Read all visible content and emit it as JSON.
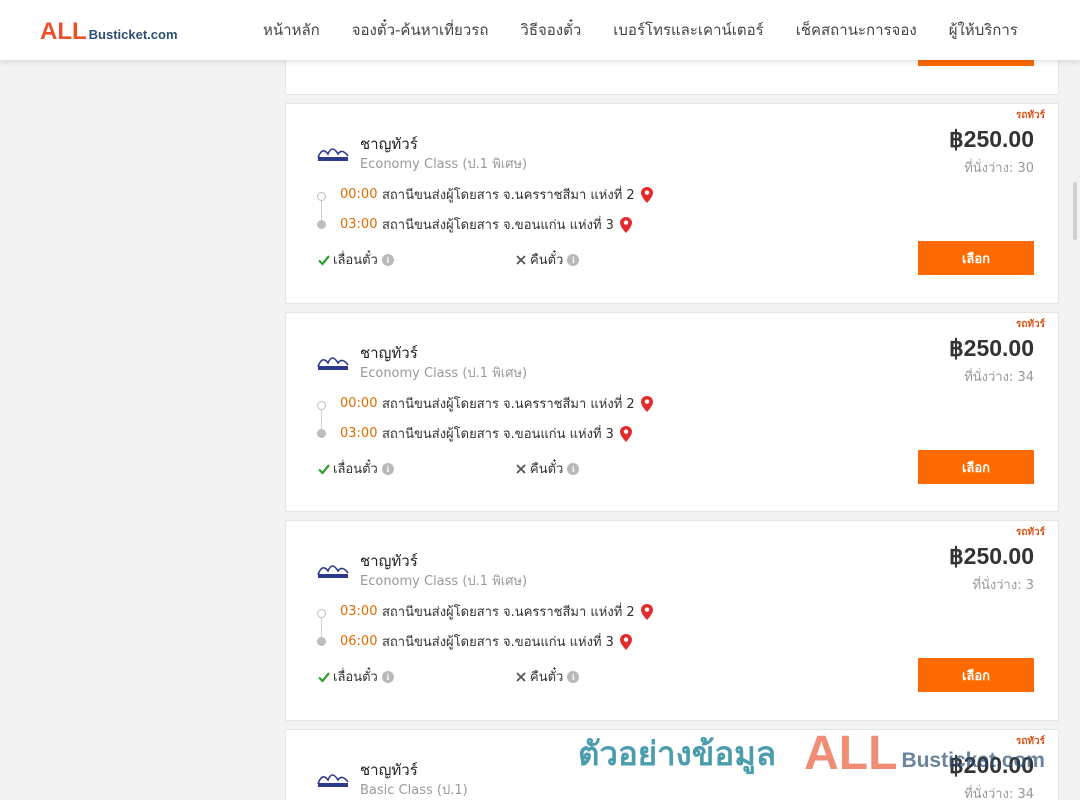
{
  "header": {
    "logo_primary": "ALL",
    "logo_secondary": "Busticket.com",
    "nav": [
      {
        "label": "หน้าหลัก"
      },
      {
        "label": "จองตั๋ว-ค้นหาเที่ยวรถ"
      },
      {
        "label": "วิธีจองตั๋ว"
      },
      {
        "label": "เบอร์โทรและเคาน์เตอร์"
      },
      {
        "label": "เช็คสถานะการจอง"
      },
      {
        "label": "ผู้ให้บริการ"
      }
    ]
  },
  "trips": [
    {
      "badge": "รถทัวร์",
      "operator": "ชาญทัวร์",
      "bus_class": "Economy Class (ป.1 พิเศษ)",
      "price": "฿250.00",
      "seats": "ที่นั่งว่าง: 30",
      "depart_time": "00:00",
      "depart_station": "สถานีขนส่งผู้โดยสาร จ.นครราชสีมา แห่งที่ 2",
      "arrive_time": "03:00",
      "arrive_station": "สถานีขนส่งผู้โดยสาร จ.ขอนแก่น แห่งที่ 3",
      "reschedule_label": "เลื่อนตั๋ว",
      "refund_label": "คืนตั๋ว",
      "select_label": "เลือก"
    },
    {
      "badge": "รถทัวร์",
      "operator": "ชาญทัวร์",
      "bus_class": "Economy Class (ป.1 พิเศษ)",
      "price": "฿250.00",
      "seats": "ที่นั่งว่าง: 34",
      "depart_time": "00:00",
      "depart_station": "สถานีขนส่งผู้โดยสาร จ.นครราชสีมา แห่งที่ 2",
      "arrive_time": "03:00",
      "arrive_station": "สถานีขนส่งผู้โดยสาร จ.ขอนแก่น แห่งที่ 3",
      "reschedule_label": "เลื่อนตั๋ว",
      "refund_label": "คืนตั๋ว",
      "select_label": "เลือก"
    },
    {
      "badge": "รถทัวร์",
      "operator": "ชาญทัวร์",
      "bus_class": "Economy Class (ป.1 พิเศษ)",
      "price": "฿250.00",
      "seats": "ที่นั่งว่าง: 3",
      "depart_time": "03:00",
      "depart_station": "สถานีขนส่งผู้โดยสาร จ.นครราชสีมา แห่งที่ 2",
      "arrive_time": "06:00",
      "arrive_station": "สถานีขนส่งผู้โดยสาร จ.ขอนแก่น แห่งที่ 3",
      "reschedule_label": "เลื่อนตั๋ว",
      "refund_label": "คืนตั๋ว",
      "select_label": "เลือก"
    },
    {
      "badge": "รถทัวร์",
      "operator": "ชาญทัวร์",
      "bus_class": "Basic Class (ป.1)",
      "price": "฿200.00",
      "seats": "ที่นั่งว่าง: 34"
    }
  ],
  "watermark": {
    "text": "ตัวอย่างข้อมูล",
    "brand_primary": "ALL",
    "brand_secondary": "Busticket.com"
  },
  "colors": {
    "accent": "#ff6a00",
    "time": "#e06b00",
    "badge": "#d9541a",
    "check": "#2e9e2e",
    "pin": "#e32b2b"
  }
}
